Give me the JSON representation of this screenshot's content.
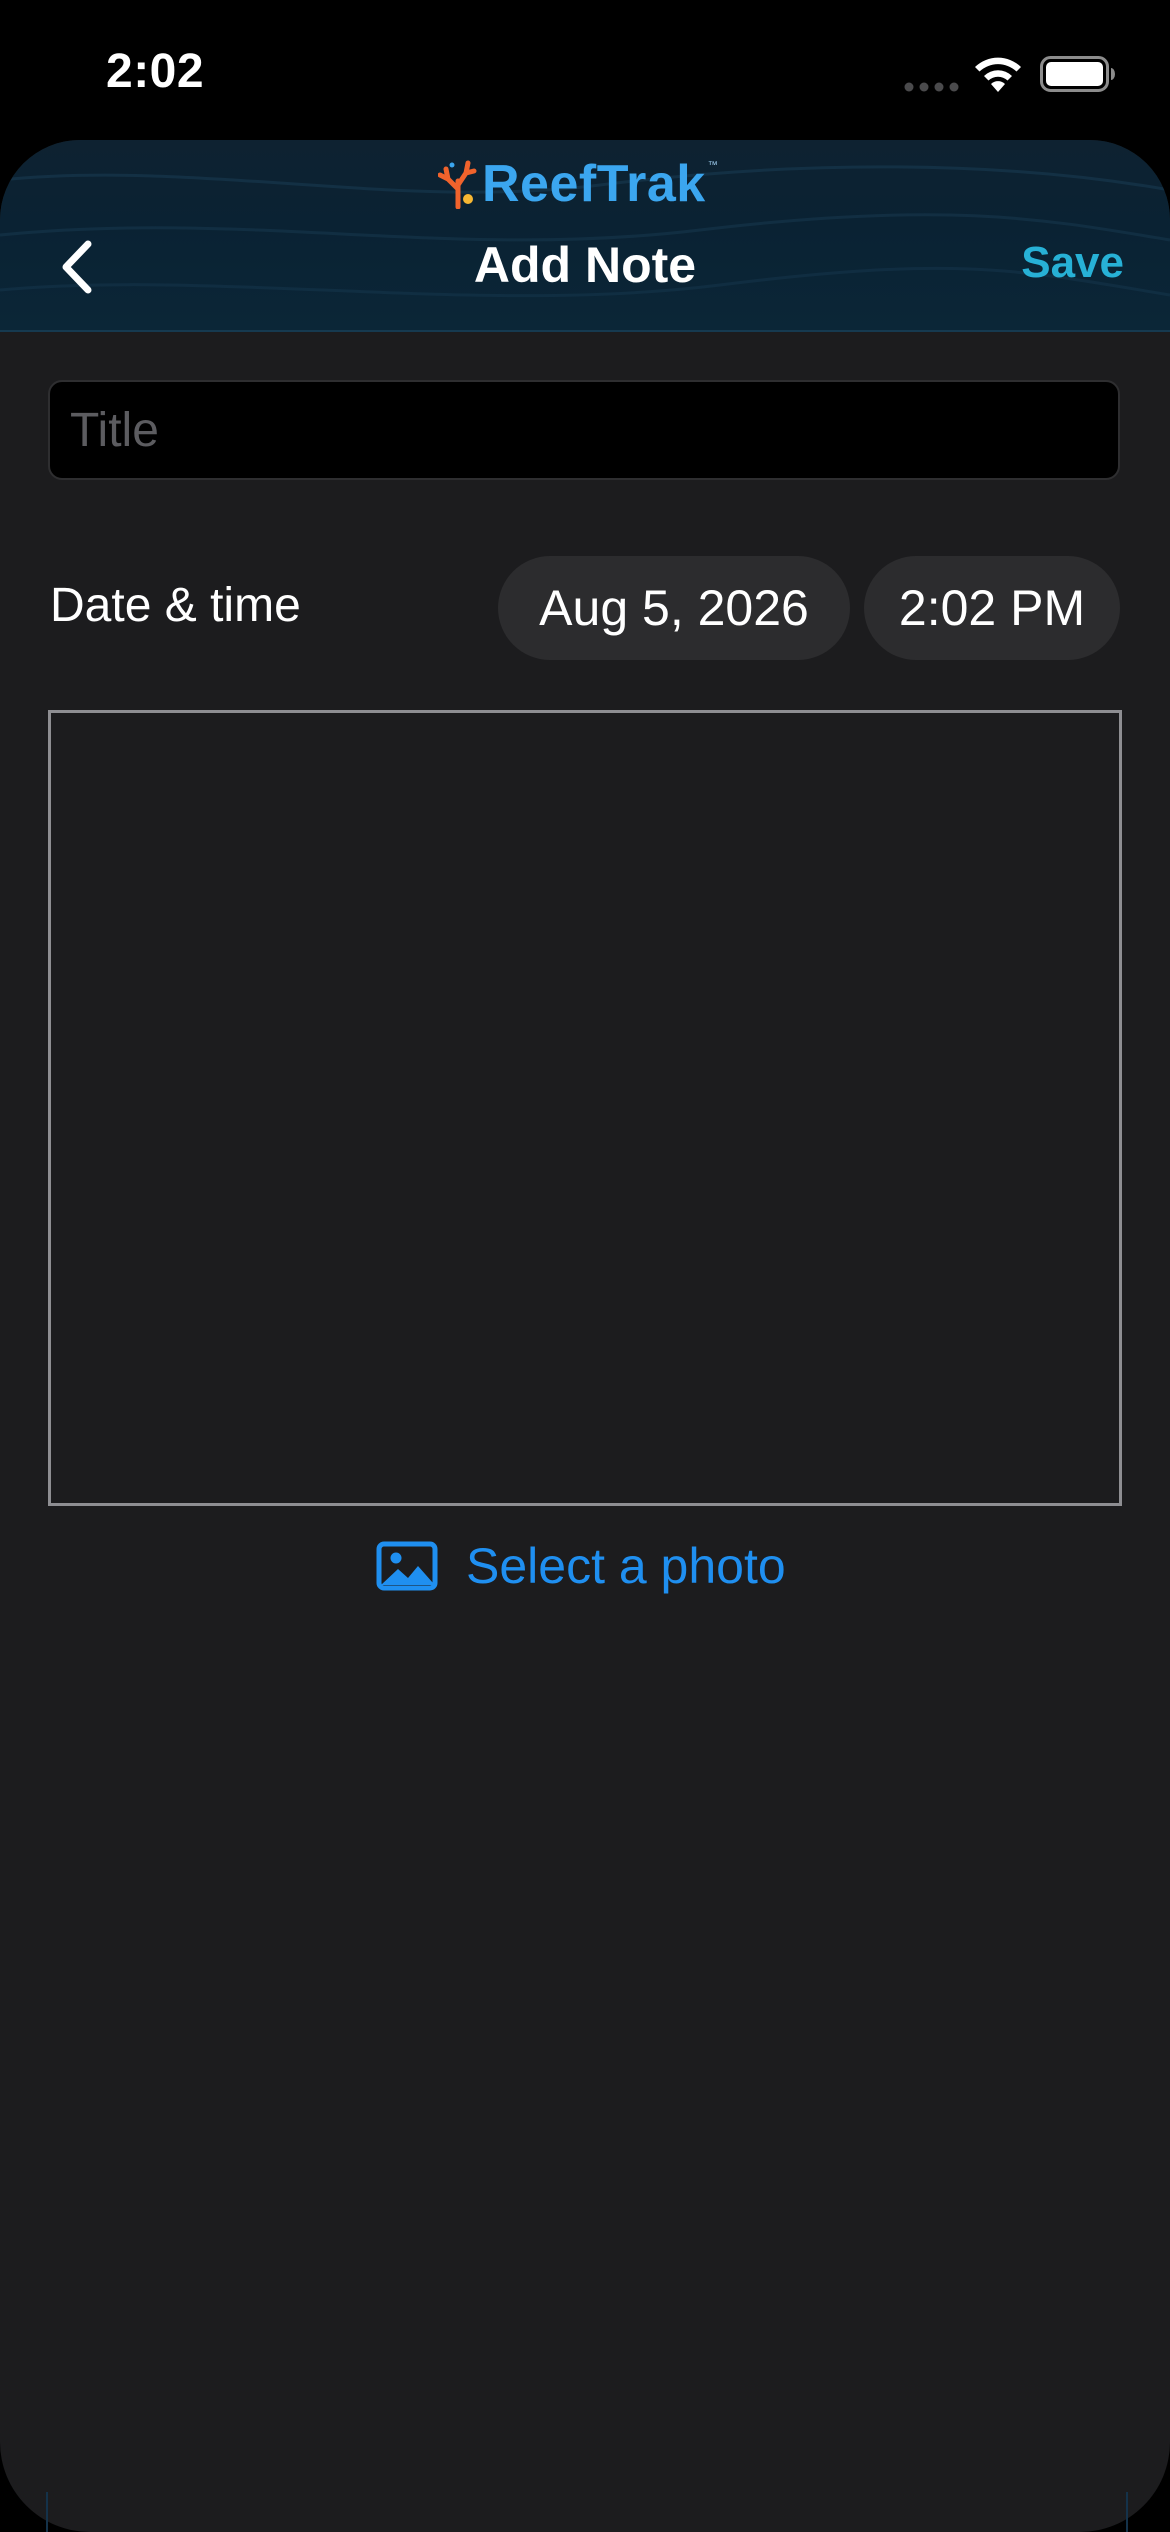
{
  "status_bar": {
    "time": "2:02"
  },
  "header": {
    "logo_text": "ReefTrak",
    "logo_tm": "™",
    "title": "Add Note",
    "save_label": "Save"
  },
  "form": {
    "title_placeholder": "Title",
    "title_value": "",
    "date_label": "Date & time",
    "date_value": "Aug 5, 2026",
    "time_value": "2:02 PM",
    "note_value": "",
    "select_photo_label": "Select a photo"
  },
  "colors": {
    "background": "#1c1c1e",
    "accent_save": "#27b1d6",
    "link_blue": "#1f8ff0",
    "logo_blue": "#3ba6ef",
    "logo_coral": "#f0632c",
    "pill": "#2c2c2e"
  },
  "icons": {
    "back": "chevron-left-icon",
    "photo": "photo-icon",
    "wifi": "wifi-icon",
    "battery": "battery-icon",
    "cellular": "cellular-icon"
  }
}
